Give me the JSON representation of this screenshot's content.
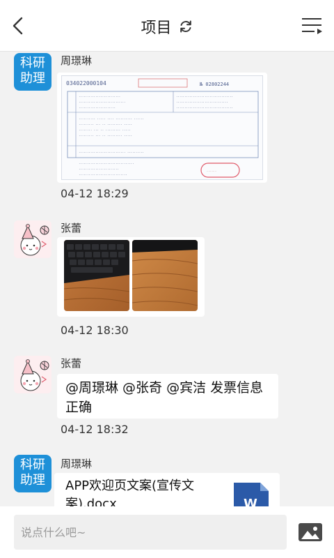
{
  "header": {
    "title": "项目",
    "back_icon": "chevron-left-icon",
    "refresh_icon": "refresh-icon",
    "menu_icon": "list-menu-icon"
  },
  "messages": [
    {
      "sender": "周璟琳",
      "avatar_text": [
        "科研",
        "助理"
      ],
      "type": "image",
      "content": "invoice-photo",
      "time": "04-12 18:29"
    },
    {
      "sender": "张蕾",
      "avatar_icon": "cartoon-girl-avatar",
      "type": "images",
      "content": [
        "keyboard-photo",
        "wooden-desk-photo"
      ],
      "time": "04-12 18:30"
    },
    {
      "sender": "张蕾",
      "avatar_icon": "cartoon-girl-avatar",
      "type": "text",
      "text_line1": "@周璟琳 @张奇 @宾洁 发票信息",
      "text_line2": "正确",
      "time": "04-12 18:32"
    },
    {
      "sender": "周璟琳",
      "avatar_text": [
        "科研",
        "助理"
      ],
      "type": "file",
      "file_name_line1": "APP欢迎页文案(宣传文",
      "file_name_line2": "案).docx",
      "file_icon": "word-document-icon"
    }
  ],
  "input": {
    "placeholder": "说点什么吧~",
    "value": ""
  },
  "input_bar": {
    "image_icon": "image-picture-icon"
  },
  "colors": {
    "avatar_blue": "#1e90d8",
    "background": "#f2f2f2",
    "word_blue": "#2b5aa8"
  }
}
